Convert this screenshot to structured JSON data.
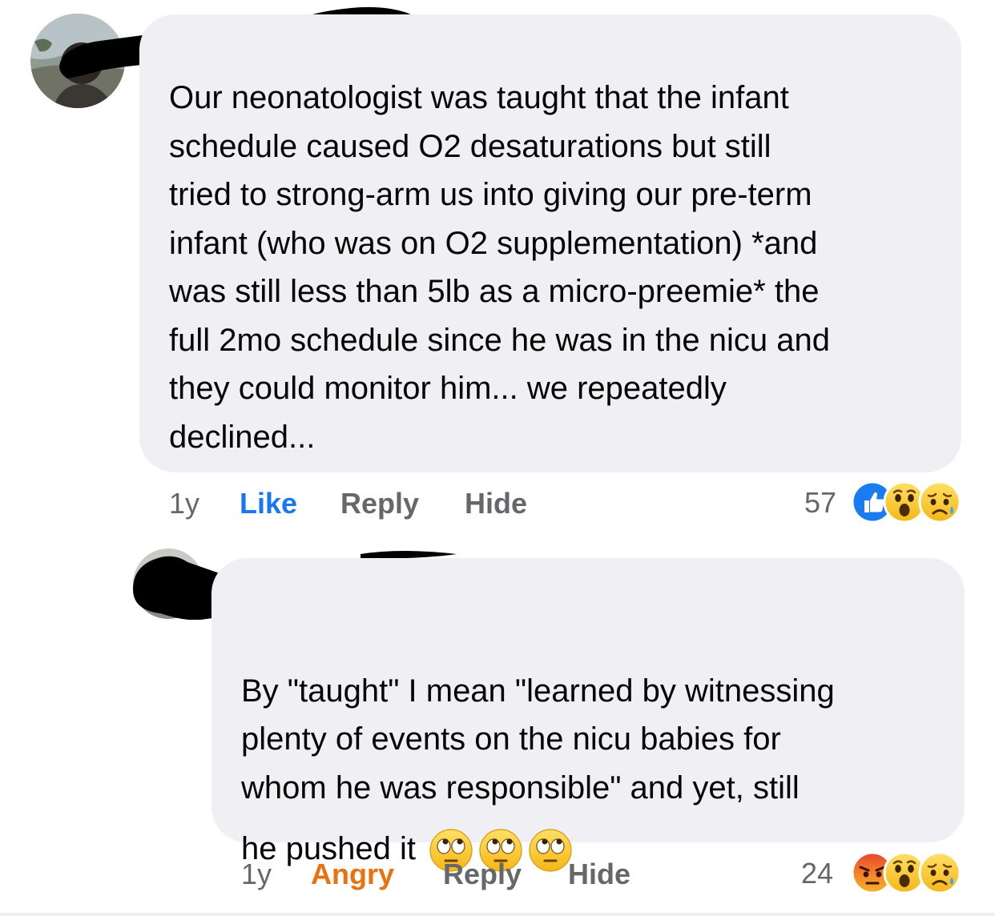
{
  "comments": [
    {
      "text": "Our neonatologist was taught that the infant\nschedule caused O2 desaturations but still\ntried to strong-arm us into giving our pre-term\ninfant (who was on O2 supplementation) *and\nwas still less than 5lb as a micro-preemie* the\nfull 2mo schedule since he was in the nicu and\nthey could monitor him... we repeatedly\ndeclined...",
      "time": "1y",
      "reaction_action": "Like",
      "reply_label": "Reply",
      "hide_label": "Hide",
      "reaction_count": "57",
      "reaction_icons": [
        "like-icon",
        "wow-emoji",
        "sad-emoji"
      ],
      "action_color": "#1877f2"
    },
    {
      "text_lines": [
        "By \"taught\" I mean \"learned by witnessing",
        "plenty of events on the nicu babies for",
        "whom he was responsible\" and yet, still"
      ],
      "text_last": "he pushed it",
      "inline_emojis": [
        "eye-roll-emoji",
        "eye-roll-emoji",
        "eye-roll-emoji"
      ],
      "time": "1y",
      "reaction_action": "Angry",
      "reply_label": "Reply",
      "hide_label": "Hide",
      "reaction_count": "24",
      "reaction_icons": [
        "angry-emoji",
        "wow-emoji",
        "sad-emoji"
      ],
      "action_color": "#e9710f"
    }
  ],
  "colors": {
    "bubble": "#f0f0f4",
    "secondary_text": "#65676b",
    "like_blue": "#1877f2",
    "angry_orange": "#e9710f"
  }
}
